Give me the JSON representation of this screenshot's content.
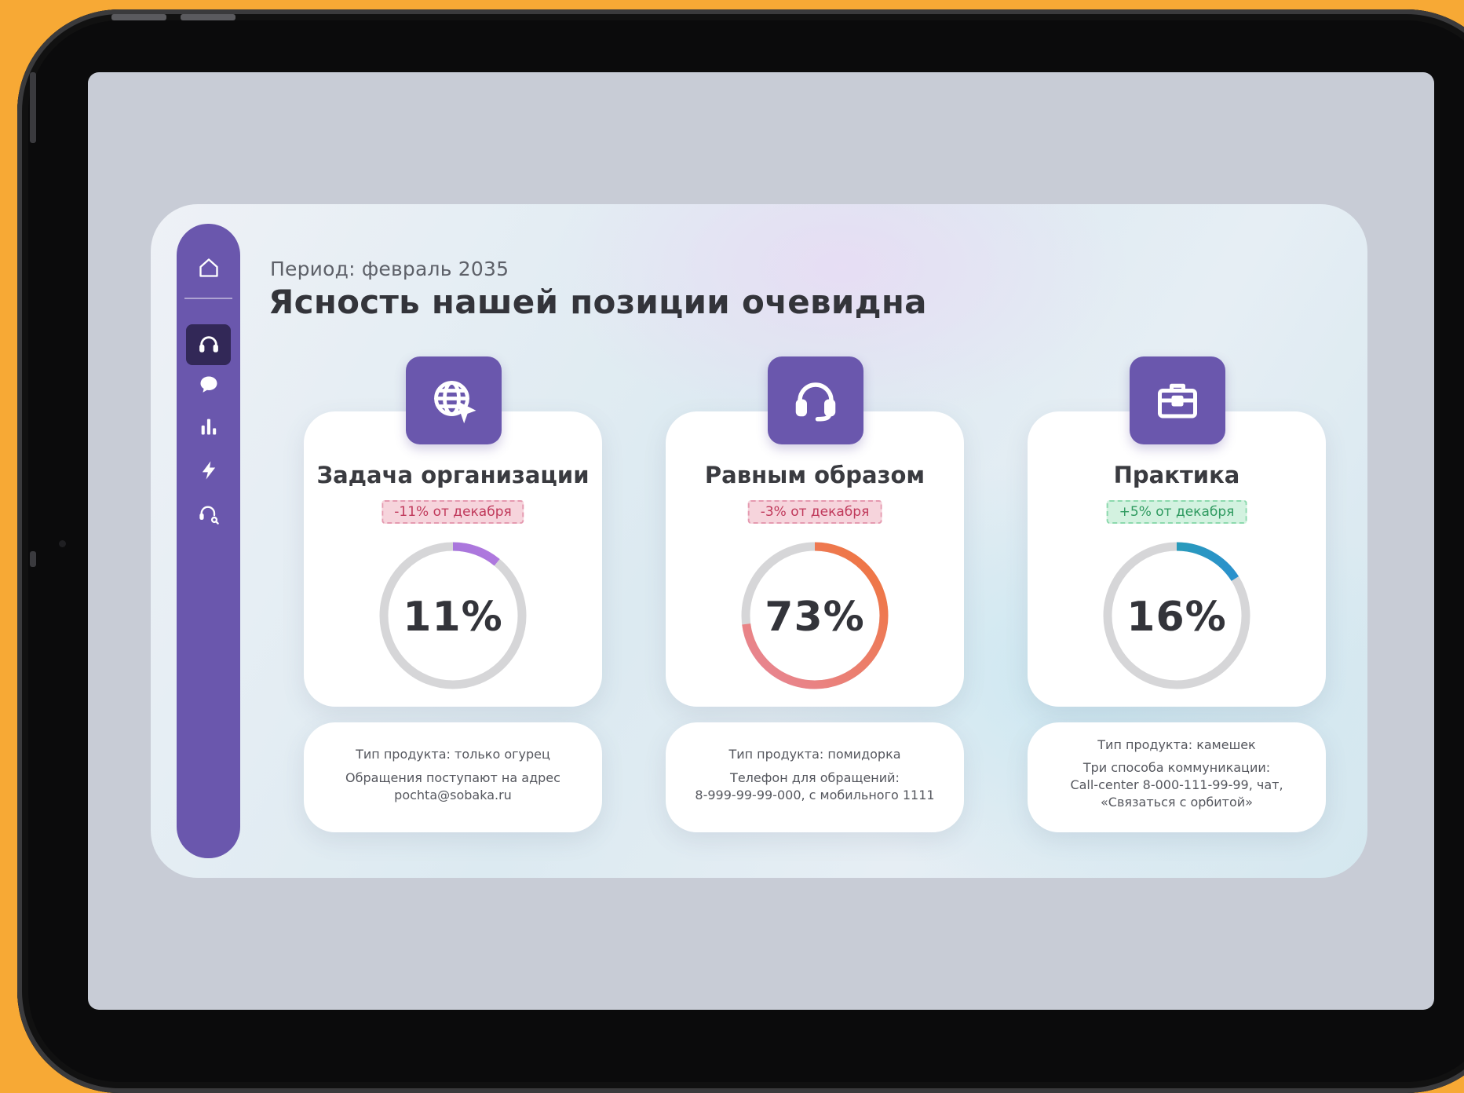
{
  "header": {
    "period": "Период: февраль 2035",
    "title": "Ясность нашей позиции очевидна"
  },
  "sidebar": {
    "items": [
      {
        "icon": "home-icon",
        "active": false
      },
      {
        "icon": "headset-icon",
        "active": true
      },
      {
        "icon": "chat-icon",
        "active": false
      },
      {
        "icon": "bar-chart-icon",
        "active": false
      },
      {
        "icon": "lightning-icon",
        "active": false
      },
      {
        "icon": "support-search-icon",
        "active": false
      }
    ],
    "color": "#6a57ad",
    "active_color": "#322857"
  },
  "cards": [
    {
      "icon": "globe-cursor-icon",
      "title": "Задача организации",
      "badge": "-11% от декабря",
      "badge_type": "negative",
      "value_label": "11%",
      "value": 0.11,
      "arc_colors": [
        "#7c6bd0",
        "#b77ae0"
      ],
      "info": {
        "type_line": "Тип продукта: только огурец",
        "line1": "Обращения поступают на адрес",
        "line2": "pochta@sobaka.ru"
      }
    },
    {
      "icon": "headset-icon",
      "title": "Равным образом",
      "badge": "-3% от декабря",
      "badge_type": "negative",
      "value_label": "73%",
      "value": 0.73,
      "arc_colors": [
        "#f0743a",
        "#e7879a"
      ],
      "info": {
        "type_line": "Тип продукта: помидорка",
        "line1": "Телефон для обращений:",
        "line2": "8-999-99-99-000, с мобильного 1111"
      }
    },
    {
      "icon": "briefcase-icon",
      "title": "Практика",
      "badge": "+5% от декабря",
      "badge_type": "positive",
      "value_label": "16%",
      "value": 0.16,
      "arc_colors": [
        "#26a6a4",
        "#2b8fd0"
      ],
      "info": {
        "type_line": "Тип продукта: камешек",
        "line1": "Три способа коммуникации:",
        "line2": "Call-center 8-000-111-99-99, чат,",
        "line3": "«Связаться с орбитой»"
      }
    }
  ]
}
